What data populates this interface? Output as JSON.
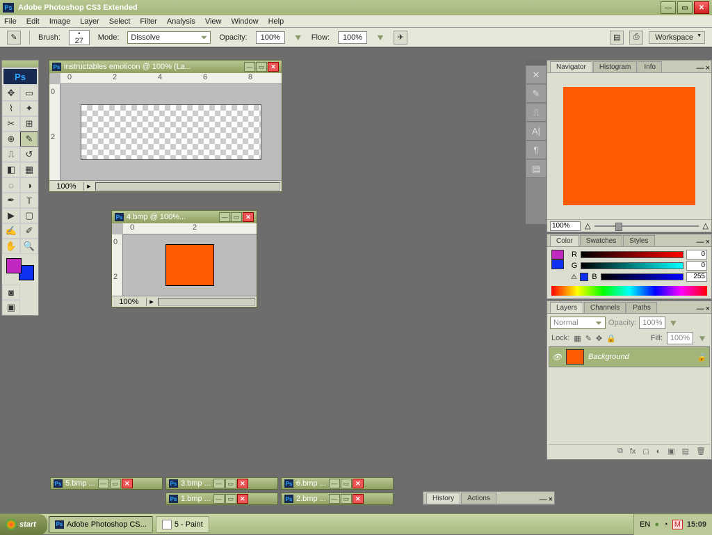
{
  "app_title": "Adobe Photoshop CS3 Extended",
  "menu": [
    "File",
    "Edit",
    "Image",
    "Layer",
    "Select",
    "Filter",
    "Analysis",
    "View",
    "Window",
    "Help"
  ],
  "options": {
    "brush_label": "Brush:",
    "brush_size": "27",
    "mode_label": "Mode:",
    "mode_value": "Dissolve",
    "opacity_label": "Opacity:",
    "opacity_value": "100%",
    "flow_label": "Flow:",
    "flow_value": "100%",
    "workspace_label": "Workspace"
  },
  "doc1": {
    "title": "instructables emoticon @ 100% (La...",
    "zoom": "100%",
    "ruler": [
      "0",
      "2",
      "4",
      "6",
      "8"
    ],
    "rv": [
      "0",
      "2"
    ]
  },
  "doc2": {
    "title": "4.bmp @ 100%...",
    "zoom": "100%",
    "ruler": [
      "0",
      "2"
    ],
    "rv": [
      "0",
      "2"
    ]
  },
  "min_docs": [
    "5.bmp ...",
    "3.bmp ...",
    "6.bmp ...",
    "1.bmp ...",
    "2.bmp ..."
  ],
  "navigator": {
    "tabs": [
      "Navigator",
      "Histogram",
      "Info"
    ],
    "zoom": "100%"
  },
  "color": {
    "tabs": [
      "Color",
      "Swatches",
      "Styles"
    ],
    "r": "0",
    "g": "0",
    "b": "255"
  },
  "layers": {
    "tabs": [
      "Layers",
      "Channels",
      "Paths"
    ],
    "blend": "Normal",
    "opacity_label": "Opacity:",
    "opacity": "100%",
    "lock_label": "Lock:",
    "fill_label": "Fill:",
    "fill": "100%",
    "layer_name": "Background"
  },
  "history": {
    "tabs": [
      "History",
      "Actions"
    ]
  },
  "taskbar": {
    "start": "start",
    "items": [
      "Adobe Photoshop CS...",
      "5 - Paint"
    ],
    "lang": "EN",
    "time": "15:09"
  }
}
